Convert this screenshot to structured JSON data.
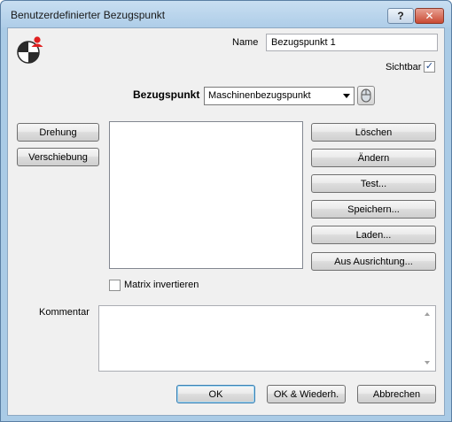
{
  "window": {
    "title": "Benutzerdefinierter Bezugspunkt",
    "help_label": "?",
    "close_label": "✕"
  },
  "name": {
    "label": "Name",
    "value": "Bezugspunkt 1"
  },
  "visible": {
    "label": "Sichtbar",
    "checked": true,
    "mark": "✓"
  },
  "reference": {
    "label": "Bezugspunkt",
    "selected": "Maschinenbezugspunkt",
    "pick_icon": "mouse-icon"
  },
  "left_buttons": {
    "rotation": "Drehung",
    "translation": "Verschiebung"
  },
  "right_buttons": {
    "delete": "Löschen",
    "modify": "Ändern",
    "test": "Test...",
    "save": "Speichern...",
    "load": "Laden...",
    "from_alignment": "Aus Ausrichtung..."
  },
  "invert": {
    "label": "Matrix invertieren",
    "checked": false
  },
  "comment": {
    "label": "Kommentar",
    "value": ""
  },
  "footer": {
    "ok": "OK",
    "ok_repeat": "OK & Wiederh.",
    "cancel": "Abbrechen"
  },
  "colors": {
    "title_bar": "#aecde8",
    "client_bg": "#f0f0f0",
    "close_button": "#c94a33",
    "logo_red": "#e02020",
    "default_button_border": "#3c7fb1"
  }
}
